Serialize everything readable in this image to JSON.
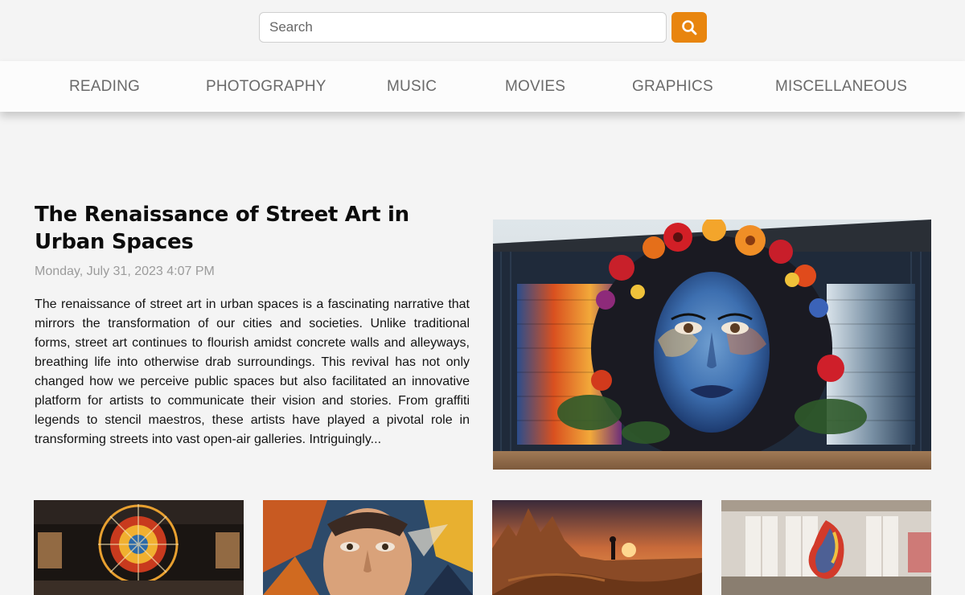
{
  "search": {
    "placeholder": "Search",
    "value": ""
  },
  "nav": {
    "items": [
      {
        "label": "READING"
      },
      {
        "label": "PHOTOGRAPHY"
      },
      {
        "label": "MUSIC"
      },
      {
        "label": "MOVIES"
      },
      {
        "label": "GRAPHICS"
      },
      {
        "label": "MISCELLANEOUS"
      }
    ]
  },
  "featured": {
    "title": "The Renaissance of Street Art in Urban Spaces",
    "date": "Monday, July 31, 2023 4:07 PM",
    "excerpt": "The renaissance of street art in urban spaces is a fascinating narrative that mirrors the transformation of our cities and societies. Unlike traditional forms, street art continues to flourish amidst concrete walls and alleyways, breathing life into otherwise drab surroundings. This revival has not only changed how we perceive public spaces but also facilitated an innovative platform for artists to communicate their vision and stories. From graffiti legends to stencil maestros, these artists have played a pivotal role in transforming streets into vast open-air galleries. Intriguingly..."
  },
  "colors": {
    "accent": "#e8850e",
    "background": "#f4f4f4",
    "nav_text": "#6a6a6a",
    "date_text": "#9b9b9b"
  },
  "icons": {
    "search_button": "search-icon"
  }
}
